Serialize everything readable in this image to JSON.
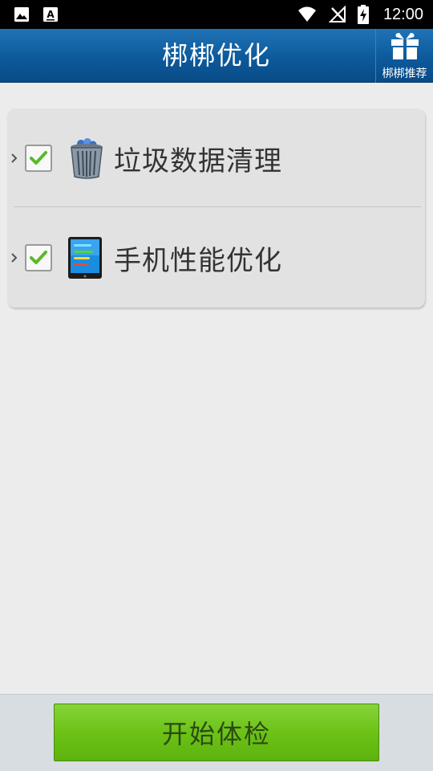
{
  "status_bar": {
    "time": "12:00",
    "icons": [
      "image-icon",
      "font-a-icon",
      "wifi-icon",
      "no-signal-icon",
      "battery-charging-icon"
    ]
  },
  "header": {
    "title": "梆梆优化",
    "recommend_label": "梆梆推荐",
    "recommend_icon": "gift-icon"
  },
  "items": [
    {
      "label": "垃圾数据清理",
      "checked": true,
      "icon": "trash-bin-icon"
    },
    {
      "label": "手机性能优化",
      "checked": true,
      "icon": "phone-performance-icon"
    }
  ],
  "start_button": {
    "label": "开始体检"
  },
  "colors": {
    "header": "#0d5a9b",
    "button": "#6cc217",
    "check": "#5cb82a"
  }
}
